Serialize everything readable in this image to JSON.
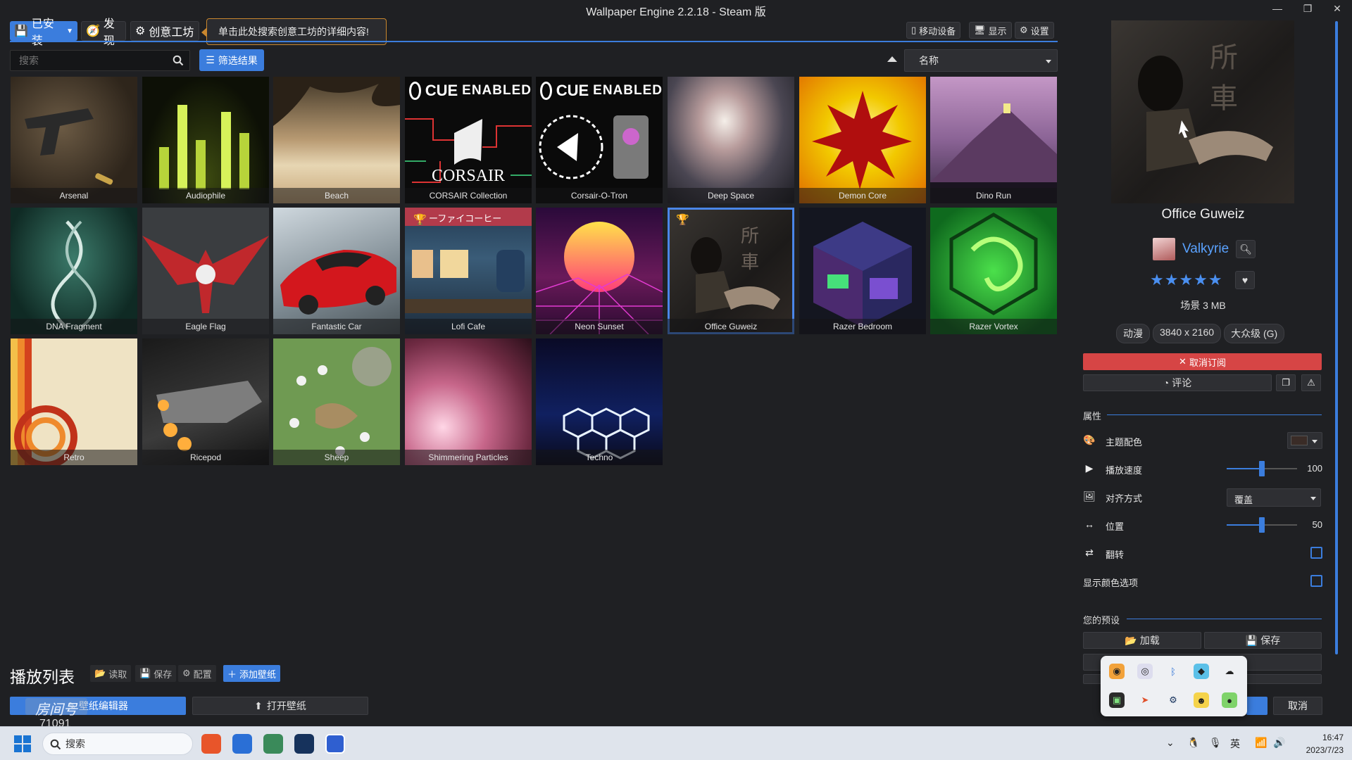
{
  "window": {
    "title": "Wallpaper Engine 2.2.18 - Steam 版"
  },
  "tabs": [
    {
      "label": "已安装",
      "icon": "save-icon"
    },
    {
      "label": "发现",
      "icon": "compass-icon"
    },
    {
      "label": "创意工坊",
      "icon": "steam-icon"
    }
  ],
  "tooltip": "单击此处搜索创意工坊的详细内容!",
  "top_right": {
    "mobile": "移动设备",
    "display": "显示",
    "settings": "设置"
  },
  "search": {
    "placeholder": "搜索",
    "filter_label": "筛选结果"
  },
  "sort": {
    "value": "名称"
  },
  "wallpapers": [
    {
      "name": "Arsenal"
    },
    {
      "name": "Audiophile"
    },
    {
      "name": "Beach"
    },
    {
      "name": "CORSAIR Collection"
    },
    {
      "name": "Corsair-O-Tron"
    },
    {
      "name": "Deep Space"
    },
    {
      "name": "Demon Core"
    },
    {
      "name": "Dino Run"
    },
    {
      "name": "DNA Fragment"
    },
    {
      "name": "Eagle Flag"
    },
    {
      "name": "Fantastic Car"
    },
    {
      "name": "Lofi Cafe"
    },
    {
      "name": "Neon Sunset"
    },
    {
      "name": "Office Guweiz"
    },
    {
      "name": "Razer Bedroom"
    },
    {
      "name": "Razer Vortex"
    },
    {
      "name": "Retro"
    },
    {
      "name": "Ricepod"
    },
    {
      "name": "Sheep"
    },
    {
      "name": "Shimmering Particles"
    },
    {
      "name": "Techno"
    }
  ],
  "cue_badge": {
    "cue": "CUE",
    "enabled": "ENABLED",
    "corsair": "CORSAIR"
  },
  "tile_text": {
    "lofi_sign": "ーファイコーヒー",
    "kanji": "所 車"
  },
  "details": {
    "title": "Office Guweiz",
    "author": "Valkyrie",
    "rating": "★★★★★",
    "meta": "场景 3 MB",
    "tags": [
      "动漫",
      "3840 x 2160",
      "大众级 (G)"
    ],
    "unsubscribe": "取消订阅",
    "comment": "评论"
  },
  "properties": {
    "section": "属性",
    "items": [
      {
        "label": "主题配色",
        "icon": "palette-icon"
      },
      {
        "label": "播放速度",
        "icon": "play-icon",
        "value": "100",
        "level": 0.5
      },
      {
        "label": "对齐方式",
        "icon": "image-icon",
        "select": "覆盖"
      },
      {
        "label": "位置",
        "icon": "arrows-horizontal-icon",
        "value": "50",
        "level": 0.5
      },
      {
        "label": "翻转",
        "icon": "swap-icon"
      },
      {
        "label": "显示颜色选项"
      }
    ]
  },
  "presets": {
    "section": "您的预设",
    "load": "加载",
    "save": "保存"
  },
  "cancel": "取消",
  "playlist": {
    "title": "播放列表",
    "load": "读取",
    "save": "保存",
    "config": "配置",
    "add": "添加壁纸"
  },
  "bottom": {
    "editor": "壁纸编辑器",
    "open": "打开壁纸"
  },
  "watermark": {
    "text": "房间号",
    "number": "71091"
  },
  "taskbar": {
    "search": "搜索",
    "ime": "英",
    "time": "16:47",
    "date": "2023/7/23"
  }
}
